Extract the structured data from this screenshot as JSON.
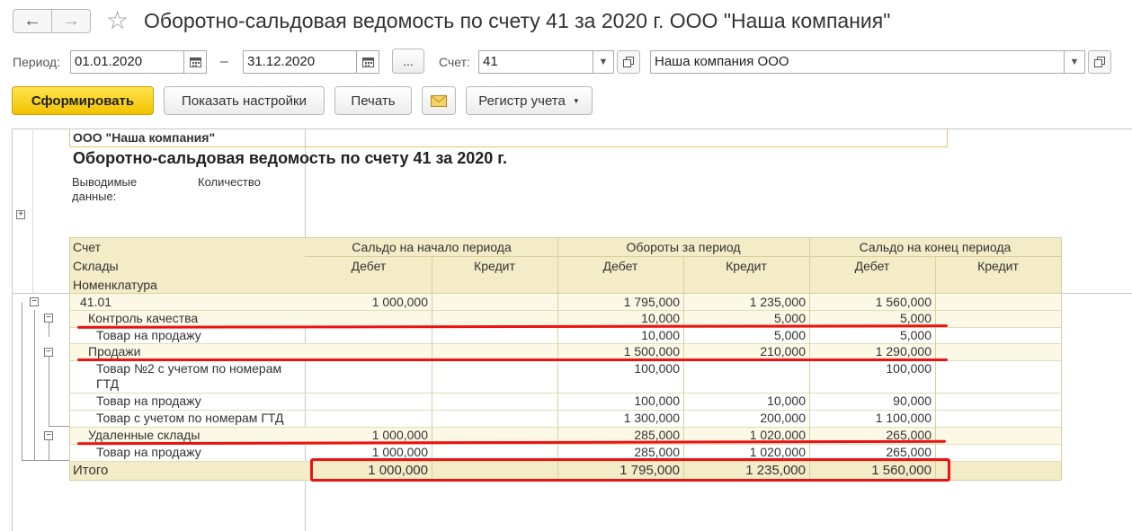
{
  "window": {
    "title": "Оборотно-сальдовая ведомость по счету 41 за 2020 г. ООО \"Наша компания\"",
    "back_icon": "arrow-left-icon",
    "forward_icon": "arrow-right-icon",
    "favorite_icon": "star-icon"
  },
  "params": {
    "period_label": "Период:",
    "date_from": "01.01.2020",
    "dash": "–",
    "date_to": "31.12.2020",
    "period_button": "...",
    "account_label": "Счет:",
    "account_value": "41",
    "organization_value": "Наша компания ООО"
  },
  "toolbar": {
    "generate": "Сформировать",
    "show_settings": "Показать настройки",
    "print": "Печать",
    "register": "Регистр учета"
  },
  "report": {
    "company": "ООО \"Наша компания\"",
    "heading": "Оборотно-сальдовая ведомость по счету 41 за 2020 г.",
    "shown_data_label": "Выводимые данные:",
    "shown_data_value": "Количество",
    "header_rows": [
      "Счет",
      "Склады",
      "Номенклатура"
    ],
    "groups": {
      "opening": "Сальдо на начало периода",
      "turnover": "Обороты за период",
      "closing": "Сальдо на конец периода"
    },
    "debit": "Дебет",
    "credit": "Кредит",
    "rows": [
      {
        "name": "41.01",
        "od": "1 000,000",
        "oc": "",
        "td": "1 795,000",
        "tc": "1 235,000",
        "cd": "1 560,000",
        "cc": ""
      },
      {
        "name": "Контроль качества",
        "od": "",
        "oc": "",
        "td": "10,000",
        "tc": "5,000",
        "cd": "5,000",
        "cc": ""
      },
      {
        "name": "Товар на продажу",
        "od": "",
        "oc": "",
        "td": "10,000",
        "tc": "5,000",
        "cd": "5,000",
        "cc": ""
      },
      {
        "name": "Продажи",
        "od": "",
        "oc": "",
        "td": "1 500,000",
        "tc": "210,000",
        "cd": "1 290,000",
        "cc": ""
      },
      {
        "name": "Товар №2 с учетом по номерам ГТД",
        "od": "",
        "oc": "",
        "td": "100,000",
        "tc": "",
        "cd": "100,000",
        "cc": ""
      },
      {
        "name": "Товар на продажу",
        "od": "",
        "oc": "",
        "td": "100,000",
        "tc": "10,000",
        "cd": "90,000",
        "cc": ""
      },
      {
        "name": "Товар с учетом по номерам ГТД",
        "od": "",
        "oc": "",
        "td": "1 300,000",
        "tc": "200,000",
        "cd": "1 100,000",
        "cc": ""
      },
      {
        "name": "Удаленные склады",
        "od": "1 000,000",
        "oc": "",
        "td": "285,000",
        "tc": "1 020,000",
        "cd": "265,000",
        "cc": ""
      },
      {
        "name": "Товар на продажу",
        "od": "1 000,000",
        "oc": "",
        "td": "285,000",
        "tc": "1 020,000",
        "cd": "265,000",
        "cc": ""
      }
    ],
    "total": {
      "name": "Итого",
      "od": "1 000,000",
      "oc": "",
      "td": "1 795,000",
      "tc": "1 235,000",
      "cd": "1 560,000",
      "cc": ""
    }
  }
}
